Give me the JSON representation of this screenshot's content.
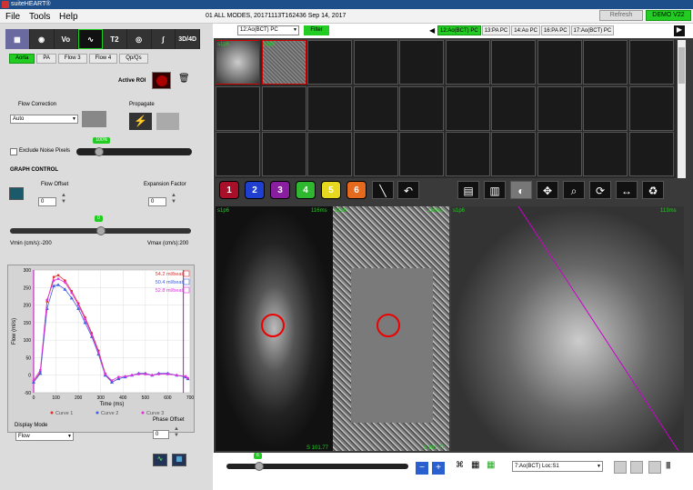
{
  "window": {
    "title": "suiteHEART®"
  },
  "menu": {
    "file": "File",
    "tools": "Tools",
    "help": "Help"
  },
  "study": {
    "info": "01 ALL MODES, 20171113T162436   Sep 14, 2017"
  },
  "buttons": {
    "refresh": "Refresh",
    "demo": "DEMO V22"
  },
  "modes": {
    "mode1": "T2",
    "mode2": "3D/4D"
  },
  "tabs": [
    "Aorta",
    "PA",
    "Flow 3",
    "Flow 4",
    "Qp/Qs"
  ],
  "roi": {
    "label": "Active ROI"
  },
  "flow_correction": {
    "label": "Flow Correction",
    "value": "Auto"
  },
  "propagate": {
    "label": "Propagate"
  },
  "noise": {
    "label": "Exclude Noise Pixels",
    "slider_value": "100%",
    "fraction": 0.2
  },
  "graph_control": {
    "label": "GRAPH CONTROL"
  },
  "flow_offset": {
    "label": "Flow Offset",
    "value": "0"
  },
  "expansion": {
    "label": "Expansion Factor",
    "value": "0"
  },
  "velocity": {
    "slider_value": "0",
    "vmin": "Vmin (cm/s):-200",
    "vmax": "Vmax (cm/s):200"
  },
  "display_mode": {
    "label": "Display Mode",
    "value": "Flow"
  },
  "phase_offset": {
    "label": "Phase Offset",
    "value": "0"
  },
  "series_select": {
    "value": "12:Ao(BCT) PC"
  },
  "filter": {
    "label": "Filter"
  },
  "series_tabs": [
    "12:Ao(BCT) PC",
    "13:PA PC",
    "14:Ao PC",
    "16:PA PC",
    "17:Ao(BCT) PC"
  ],
  "roi_colors": [
    {
      "label": "1",
      "color": "#a8102a"
    },
    {
      "label": "2",
      "color": "#1e3fcf"
    },
    {
      "label": "3",
      "color": "#8a1ea0"
    },
    {
      "label": "4",
      "color": "#2fb82f"
    },
    {
      "label": "5",
      "color": "#e6d81e"
    },
    {
      "label": "6",
      "color": "#e66a1e"
    }
  ],
  "images": {
    "a": {
      "tl": "s1p6",
      "tr": "116ms",
      "bl": "",
      "br": "S 101.77"
    },
    "b": {
      "tl": "s1p6",
      "tr": "116ms",
      "bl": "",
      "br": "S 101.77"
    },
    "c": {
      "tl": "s1p6",
      "tr": "113ms",
      "bl": "",
      "br": ""
    }
  },
  "thumbs": {
    "t1": "s1p6",
    "t2": "s1p6"
  },
  "bottom": {
    "slider_value": "6",
    "location": "7:Ao(BCT) Loc:S1"
  },
  "chart_data": {
    "type": "line",
    "title": "",
    "xlabel": "Time (ms)",
    "ylabel": "Flow (ml/s)",
    "xlim": [
      0,
      700
    ],
    "ylim": [
      -50,
      300
    ],
    "xticks": [
      0,
      100,
      200,
      300,
      400,
      500,
      600,
      700
    ],
    "yticks": [
      -50,
      0,
      50,
      100,
      150,
      200,
      250,
      300
    ],
    "legend_pos": "bottom",
    "series": [
      {
        "name": "Curve 1",
        "color": "#e03030",
        "value_label": "54.2 ml/beat",
        "marker": "star",
        "x": [
          0,
          30,
          60,
          90,
          110,
          140,
          170,
          200,
          230,
          260,
          290,
          320,
          350,
          380,
          410,
          440,
          470,
          500,
          530,
          560,
          600,
          640,
          680,
          690
        ],
        "y": [
          -20,
          10,
          210,
          280,
          285,
          270,
          240,
          205,
          165,
          120,
          70,
          5,
          -20,
          -10,
          -5,
          0,
          5,
          5,
          0,
          5,
          5,
          0,
          -5,
          -10
        ]
      },
      {
        "name": "Curve 2",
        "color": "#4060e0",
        "value_label": "50.4 ml/beat",
        "marker": "triangle",
        "x": [
          0,
          30,
          60,
          90,
          110,
          140,
          170,
          200,
          230,
          260,
          290,
          320,
          350,
          380,
          410,
          440,
          470,
          500,
          530,
          560,
          600,
          640,
          680,
          690
        ],
        "y": [
          -20,
          5,
          190,
          255,
          258,
          245,
          220,
          190,
          150,
          110,
          60,
          0,
          -20,
          -10,
          -5,
          0,
          5,
          5,
          0,
          5,
          5,
          0,
          -5,
          -10
        ]
      },
      {
        "name": "Curve 3",
        "color": "#e030e0",
        "value_label": "52.8 ml/beat",
        "marker": "star",
        "x": [
          0,
          30,
          60,
          90,
          110,
          140,
          170,
          200,
          230,
          260,
          290,
          320,
          350,
          380,
          410,
          440,
          470,
          500,
          530,
          560,
          600,
          640,
          680,
          690
        ],
        "y": [
          -15,
          15,
          215,
          270,
          275,
          265,
          235,
          200,
          160,
          115,
          65,
          3,
          -15,
          -5,
          -3,
          0,
          3,
          3,
          0,
          3,
          3,
          0,
          -3,
          -8
        ]
      }
    ]
  }
}
